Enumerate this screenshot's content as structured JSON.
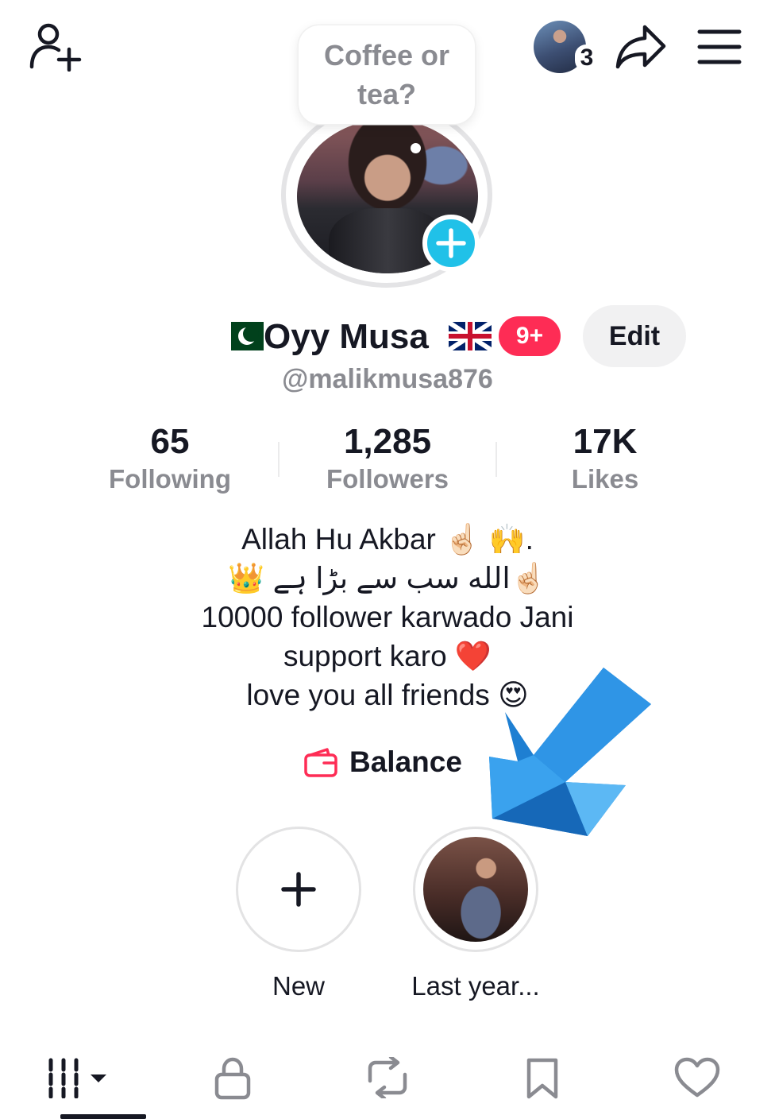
{
  "note": {
    "text": "Coffee or tea?"
  },
  "header": {
    "visitors_count": "3"
  },
  "profile": {
    "display_name": "Oyy Musa",
    "notification_badge": "9+",
    "edit_label": "Edit",
    "username": "@malikmusa876"
  },
  "stats": [
    {
      "value": "65",
      "label": "Following"
    },
    {
      "value": "1,285",
      "label": "Followers"
    },
    {
      "value": "17K",
      "label": "Likes"
    }
  ],
  "bio": [
    "Allah Hu Akbar ☝🏻 🙌.",
    "☝🏻الله سب سے بڑا ہے 👑",
    "10000 follower karwado Jani",
    "support karo ❤️",
    "love you all friends 😍"
  ],
  "balance": {
    "label": "Balance"
  },
  "highlights": [
    {
      "label": "New"
    },
    {
      "label": "Last year..."
    }
  ],
  "colors": {
    "accent_red": "#fe2c55",
    "story_add_blue": "#20c1e8",
    "text_primary": "#161823",
    "text_secondary": "#8a8b91",
    "arrow_blue": "#1e7fd2"
  },
  "icons": {
    "top_left": "add-friend-icon",
    "top_right": [
      "share-icon",
      "menu-icon"
    ],
    "tabs": [
      "videos-grid-icon",
      "lock-icon",
      "repost-icon",
      "bookmark-icon",
      "heart-icon"
    ]
  }
}
